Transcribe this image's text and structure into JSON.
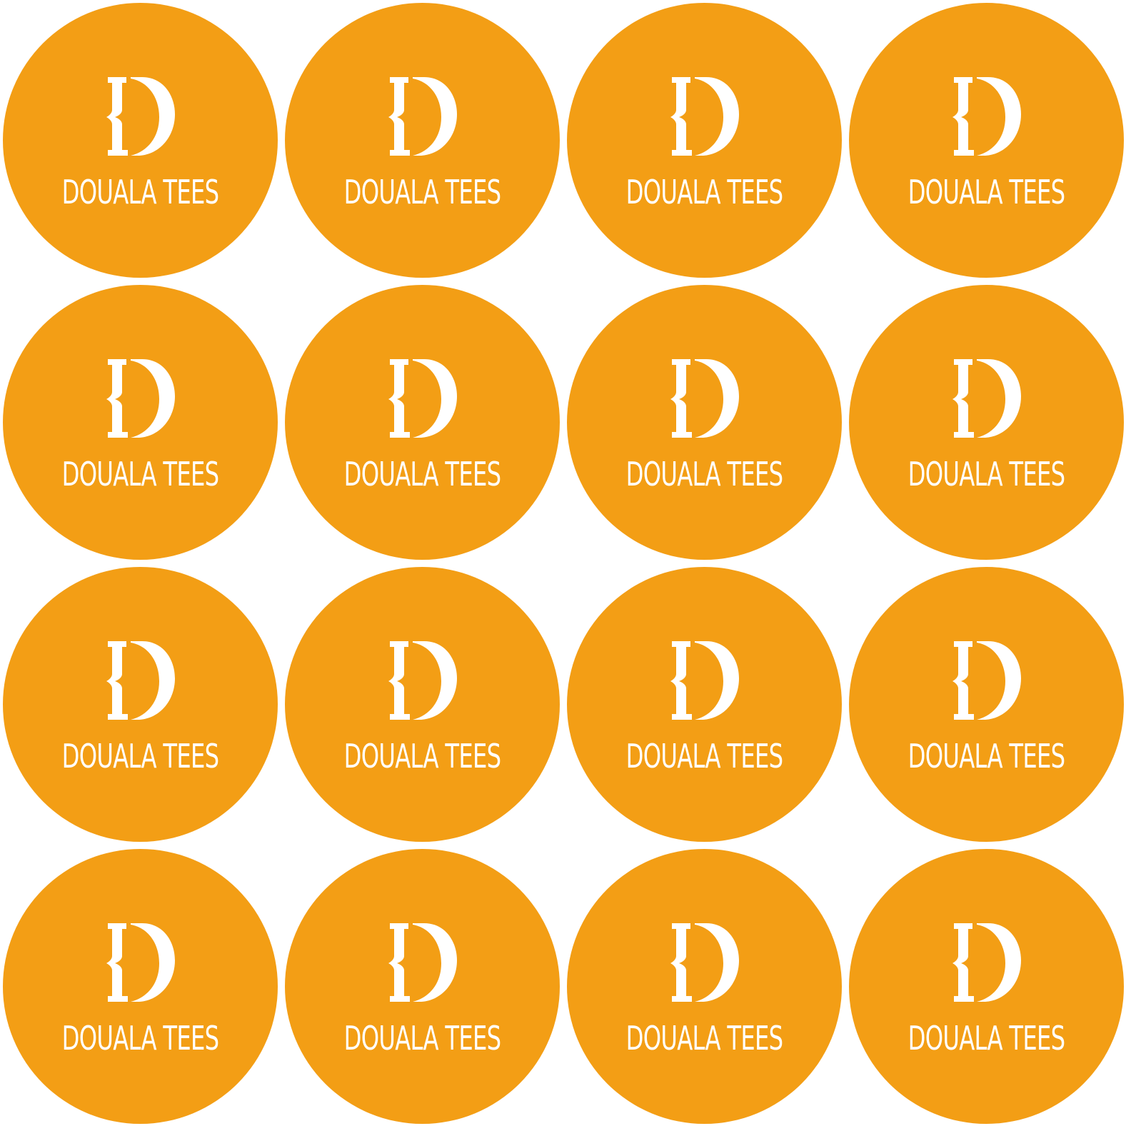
{
  "brand": {
    "name": "DOUALA TEES",
    "logo_icon": "db-monogram-icon"
  },
  "colors": {
    "sticker_fill": "#F39E15",
    "logo_ink": "#FFFFFF",
    "background": "#FFFFFF"
  },
  "sheet": {
    "rows": 4,
    "columns": 4
  }
}
